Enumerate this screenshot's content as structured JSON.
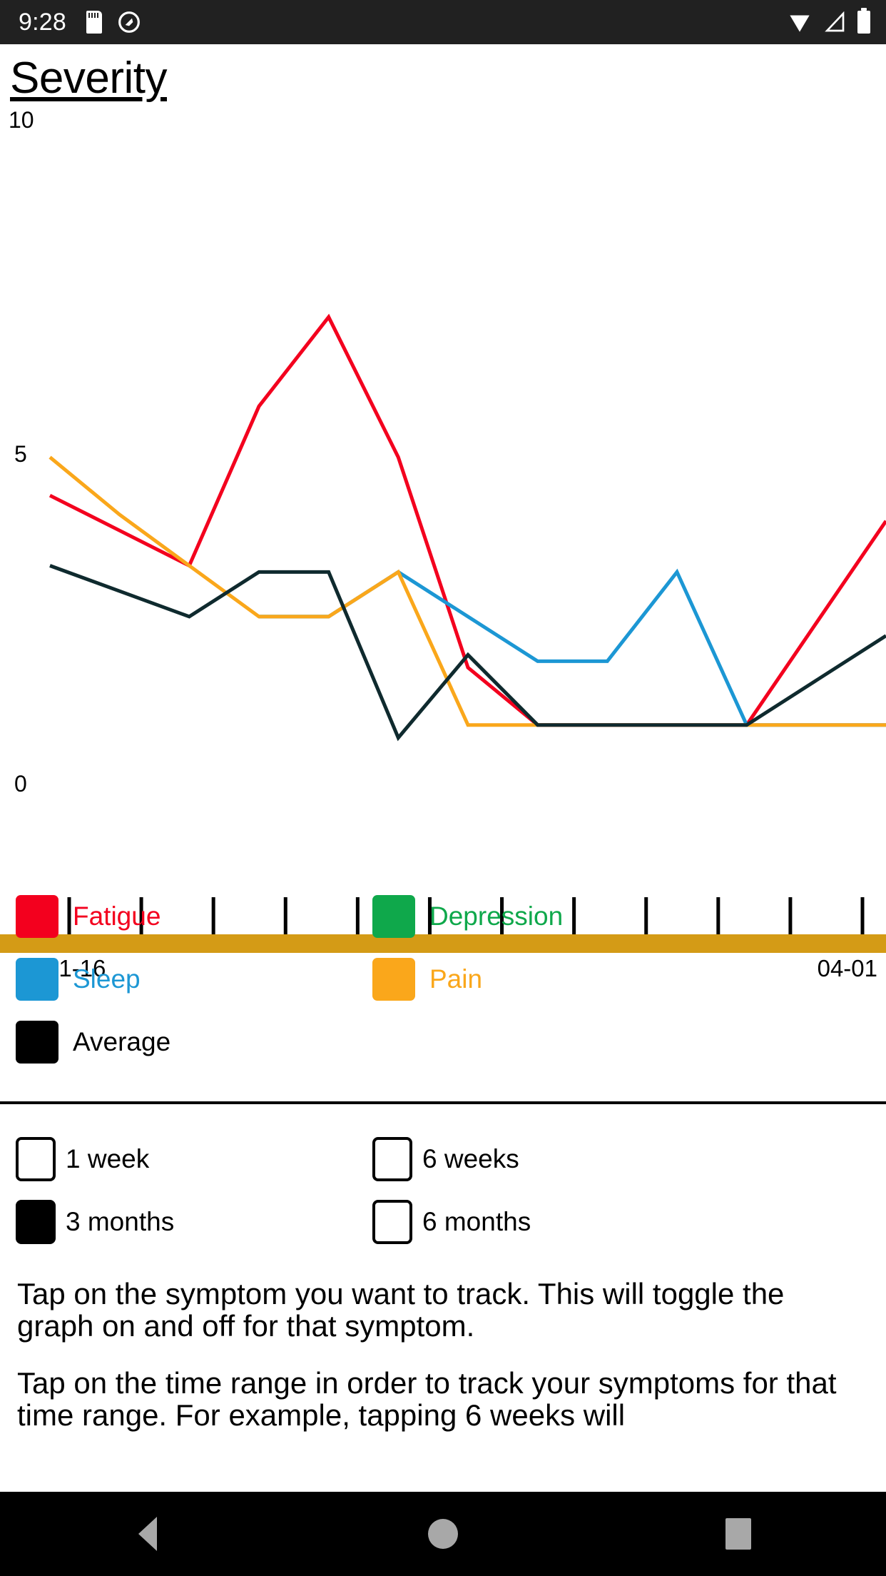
{
  "statusbar": {
    "clock": "9:28",
    "icons": [
      "sdcard-icon",
      "do-not-disturb-icon",
      "wifi-icon",
      "cell-signal-icon",
      "battery-icon"
    ]
  },
  "page": {
    "title": "Severity"
  },
  "chart_data": {
    "type": "line",
    "title": "Severity",
    "xlabel": "",
    "ylabel": "Severity",
    "ylim": [
      0,
      10
    ],
    "yticks": [
      0,
      5,
      10
    ],
    "ytick_labels": [
      "0",
      "5",
      "10"
    ],
    "grid": false,
    "legend_position": "below",
    "x_axis_start_label": "01-16",
    "x_axis_end_label": "04-01",
    "x_tick_count": 12,
    "x": [
      0,
      1,
      2,
      3,
      4,
      5,
      6,
      7,
      8,
      9,
      10,
      11,
      12
    ],
    "series": [
      {
        "name": "Fatigue",
        "color": "#F3001E",
        "values": [
          4.6,
          4.05,
          3.5,
          6.0,
          7.4,
          5.2,
          1.9,
          1.0,
          1.0,
          1.0,
          1.0,
          2.6,
          4.2
        ]
      },
      {
        "name": "Depression",
        "color": "#0FA84B",
        "values": [
          null,
          null,
          null,
          2.7,
          2.7,
          null,
          null,
          null,
          null,
          null,
          null,
          null,
          null
        ]
      },
      {
        "name": "Sleep",
        "color": "#1C97D4",
        "values": [
          null,
          null,
          null,
          2.7,
          2.7,
          3.4,
          2.7,
          2.0,
          2.0,
          3.4,
          1.0,
          1.0,
          1.0
        ]
      },
      {
        "name": "Pain",
        "color": "#FAA71B",
        "values": [
          5.2,
          4.3,
          3.5,
          2.7,
          2.7,
          3.4,
          1.0,
          1.0,
          1.0,
          1.0,
          1.0,
          1.0,
          1.0
        ]
      },
      {
        "name": "Average",
        "color": "#0F2A2E",
        "values": [
          3.5,
          3.1,
          2.7,
          3.4,
          3.4,
          0.8,
          2.1,
          1.0,
          1.0,
          1.0,
          1.0,
          1.7,
          2.4
        ]
      }
    ]
  },
  "legend": {
    "items": [
      {
        "label": "Fatigue",
        "color": "#F3001E",
        "column": "left",
        "enabled": true
      },
      {
        "label": "Sleep",
        "color": "#1C97D4",
        "column": "left",
        "enabled": true
      },
      {
        "label": "Average",
        "color": "#000000",
        "column": "left",
        "enabled": true
      },
      {
        "label": "Depression",
        "color": "#0FA84B",
        "column": "right",
        "enabled": true
      },
      {
        "label": "Pain",
        "color": "#FAA71B",
        "column": "right",
        "enabled": true
      }
    ]
  },
  "ranges": {
    "items": [
      {
        "label": "1 week",
        "column": "left",
        "checked": false
      },
      {
        "label": "3 months",
        "column": "left",
        "checked": true
      },
      {
        "label": "6 weeks",
        "column": "right",
        "checked": false
      },
      {
        "label": "6 months",
        "column": "right",
        "checked": false
      }
    ]
  },
  "help": {
    "paragraph1": "Tap on the symptom you want to track. This will toggle the graph on and off for that symptom.",
    "paragraph2": "Tap on the time range in order to track your symptoms for that time range. For example, tapping 6 weeks will"
  },
  "navbar": {
    "buttons": [
      {
        "name": "back-button",
        "icon": "triangle-left-icon"
      },
      {
        "name": "home-button",
        "icon": "circle-icon"
      },
      {
        "name": "recents-button",
        "icon": "square-icon"
      }
    ]
  },
  "colors": {
    "axis_bar": "#D49B16",
    "status_bar": "#212121",
    "nav_bar": "#000000"
  }
}
